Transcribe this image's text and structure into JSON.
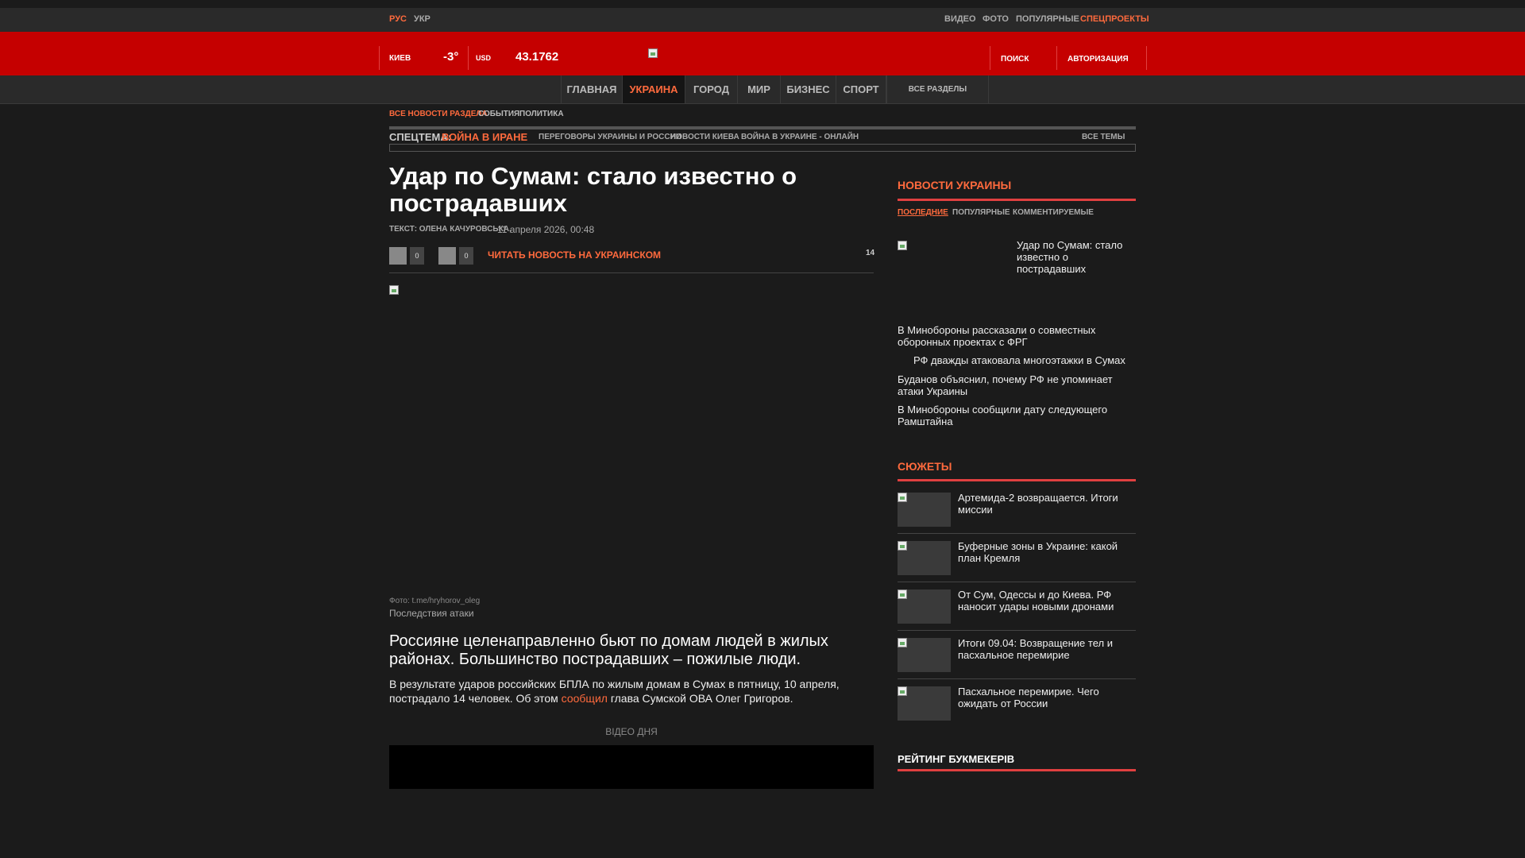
{
  "topbar": {
    "lang": [
      "РУС",
      "УКР"
    ],
    "links": [
      "ВИДЕО",
      "ФОТО",
      "ПОПУЛЯРНЫЕ",
      "СПЕЦПРОЕКТЫ"
    ]
  },
  "header": {
    "city": "КИЕВ",
    "temp": "-3°",
    "currency": "USD",
    "rate": "43.1762",
    "search": "ПОИСК",
    "auth": "АВТОРИЗАЦИЯ"
  },
  "nav": [
    "ГЛАВНАЯ",
    "УКРАИНА",
    "ГОРОД",
    "МИР",
    "БИЗНЕС",
    "СПОРТ",
    "ВСЕ РАЗДЕЛЫ"
  ],
  "subnav": [
    "ВСЕ НОВОСТИ РАЗДЕЛА",
    "СОБЫТИЯ",
    "ПОЛИТИКА"
  ],
  "spec": {
    "label": "СПЕЦТЕМА:",
    "topic": "ВОЙНА В ИРАНЕ",
    "links": [
      "ПЕРЕГОВОРЫ УКРАИНЫ И РОССИИ",
      "НОВОСТИ КИЕВА",
      "ВОЙНА В УКРАИНЕ - ОНЛАЙН"
    ],
    "all": "ВСЕ ТЕМЫ"
  },
  "article": {
    "title": "Удар по Сумам: стало известно о пострадавших",
    "author": "ТЕКСТ: ОЛЕНА КАЧУРОВСЬКА,",
    "date": "11 апреля 2026, 00:48",
    "count1": "0",
    "count2": "0",
    "read_ukr": "ЧИТАТЬ НОВОСТЬ НА УКРАИНСКОМ",
    "comments": "14",
    "photo_credit": "Фото: t.me/hryhorov_oleg",
    "photo_caption": "Последствия атаки",
    "lead": "Россияне целенаправленно бьют по домам людей в жилых районах. Большинство пострадавших – пожилые люди.",
    "body_before": "В результате ударов российских БПЛА по жилым домам в Сумах в пятницу, 10 апреля, пострадало 14 человек. Об этом ",
    "body_link": "сообщил",
    "body_after": " глава Сумской ОВА Олег Григоров.",
    "video_label": "ВІДЕО ДНЯ"
  },
  "sidebar": {
    "news_title": "НОВОСТИ УКРАИНЫ",
    "tabs": [
      "ПОСЛЕДНИЕ",
      "ПОПУЛЯРНЫЕ",
      "КОММЕНТИРУЕМЫЕ"
    ],
    "featured": "Удар по Сумам: стало известно о пострадавших",
    "news": [
      "В Минобороны рассказали о совместных оборонных проектах с ФРГ",
      "РФ дважды атаковала многоэтажки в Сумах",
      "Буданов объяснил, почему РФ не упоминает атаки Украины",
      "В Минобороны сообщили дату следующего Рамштайна"
    ],
    "stories_title": "СЮЖЕТЫ",
    "stories": [
      "Артемида-2 возвращается. Итоги миссии",
      "Буферные зоны в Украине: какой план Кремля",
      "От Сум, Одессы и до Киева. РФ наносит удары новыми дронами",
      "Итоги 09.04: Возвращение тел и пасхальное перемирие",
      "Пасхальное перемирие. Чего ожидать от России"
    ],
    "rating_title": "РЕЙТИНГ БУКМЕКЕРІВ"
  },
  "colors": {
    "accent": "#ff6a3d",
    "red": "#c50000",
    "bg": "#1b1b1b"
  }
}
